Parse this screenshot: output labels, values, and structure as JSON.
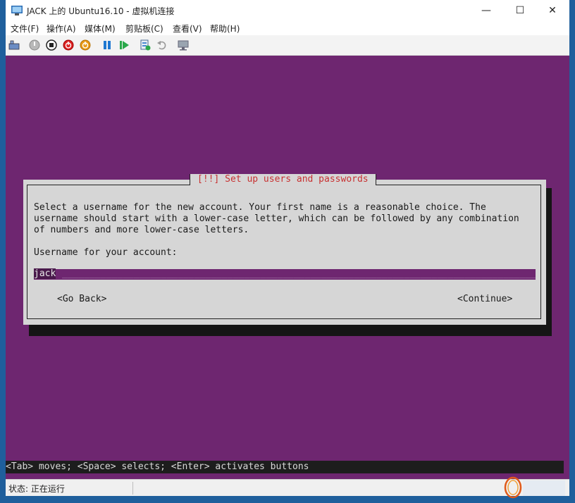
{
  "window": {
    "title": "JACK 上的 Ubuntu16.10 - 虚拟机连接",
    "minimize_glyph": "—",
    "maximize_glyph": "☐",
    "close_glyph": "✕"
  },
  "menu": {
    "items": [
      "文件(F)",
      "操作(A)",
      "媒体(M)",
      "剪贴板(C)",
      "查看(V)",
      "帮助(H)"
    ]
  },
  "toolbar": {
    "icons": [
      "ctrl-alt-del-icon",
      "start-icon",
      "turn-off-icon",
      "shutdown-icon",
      "save-icon",
      "pause-icon",
      "reset-icon",
      "checkpoint-icon",
      "revert-icon",
      "enhanced-session-icon"
    ]
  },
  "installer": {
    "dialog_title": "[!!] Set up users and passwords",
    "description_lines": [
      "Select a username for the new account. Your first name is a reasonable choice. The",
      "username should start with a lower-case letter, which can be followed by any combination",
      "of numbers and more lower-case letters."
    ],
    "prompt": "Username for your account:",
    "username_value": "jack",
    "input_fill": "_____________________________________________________________________________________________",
    "go_back_label": "<Go Back>",
    "continue_label": "<Continue>",
    "hint": "<Tab> moves; <Space> selects; <Enter> activates buttons"
  },
  "statusbar": {
    "status": "状态: 正在运行"
  },
  "colors": {
    "console_bg": "#6e2670",
    "dialog_bg": "#d6d6d6",
    "title_red": "#c83232"
  }
}
